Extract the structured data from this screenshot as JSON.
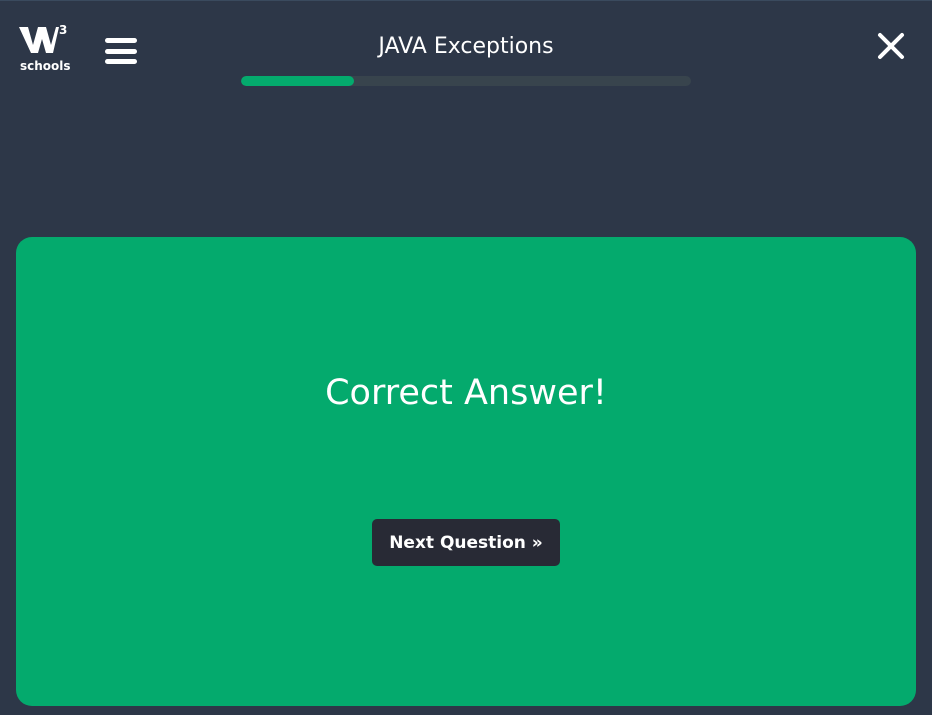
{
  "header": {
    "logo": {
      "word": "schools",
      "superscript": "3",
      "icon": "w3schools-logo-icon"
    },
    "menu_icon": "hamburger-menu-icon",
    "title": "JAVA Exceptions",
    "progress": 0.25,
    "close_icon": "close-icon"
  },
  "result": {
    "message": "Correct Answer!",
    "next_label": "Next Question »"
  },
  "colors": {
    "background": "#2d3748",
    "accent": "#04aa6d",
    "track": "#38444d",
    "button": "#282a35",
    "text": "#ffffff"
  }
}
